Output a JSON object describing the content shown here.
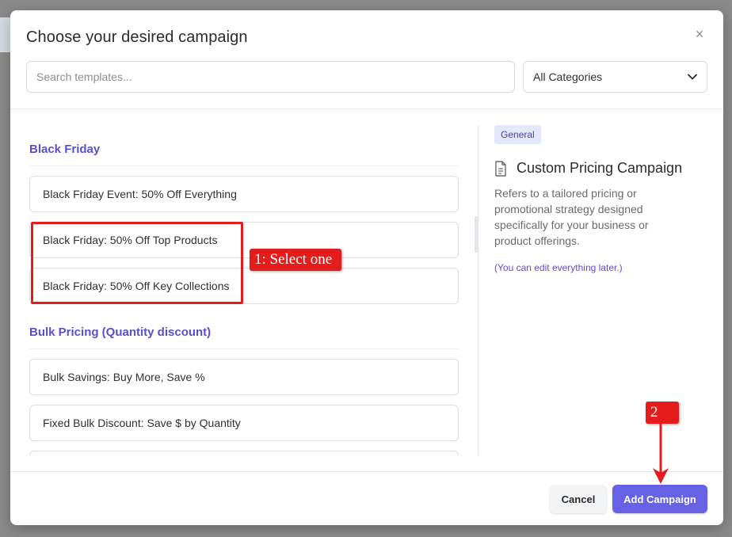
{
  "modal": {
    "title": "Choose your desired campaign",
    "close_icon": "×"
  },
  "search": {
    "placeholder": "Search templates..."
  },
  "category_filter": {
    "selected": "All Categories"
  },
  "groups": [
    {
      "heading": "Black Friday",
      "items": [
        "Black Friday Event: 50% Off Everything",
        "Black Friday: 50% Off Top Products",
        "Black Friday: 50% Off Key Collections"
      ]
    },
    {
      "heading": "Bulk Pricing (Quantity discount)",
      "items": [
        "Bulk Savings: Buy More, Save %",
        "Fixed Bulk Discount: Save $ by Quantity"
      ]
    }
  ],
  "detail": {
    "badge": "General",
    "title": "Custom Pricing Campaign",
    "description": "Refers to a tailored pricing or promotional strategy designed specifically for your business or product offerings.",
    "note": "(You can edit everything later.)",
    "icon": "document-icon"
  },
  "footer": {
    "cancel_label": "Cancel",
    "add_label": "Add Campaign"
  },
  "annotations": {
    "step1": "1: Select one",
    "step2": "2",
    "color": "#e41c1c"
  },
  "colors": {
    "accent": "#6761e6",
    "heading": "#5b4fd0",
    "badge_bg": "#e5e7fb"
  }
}
